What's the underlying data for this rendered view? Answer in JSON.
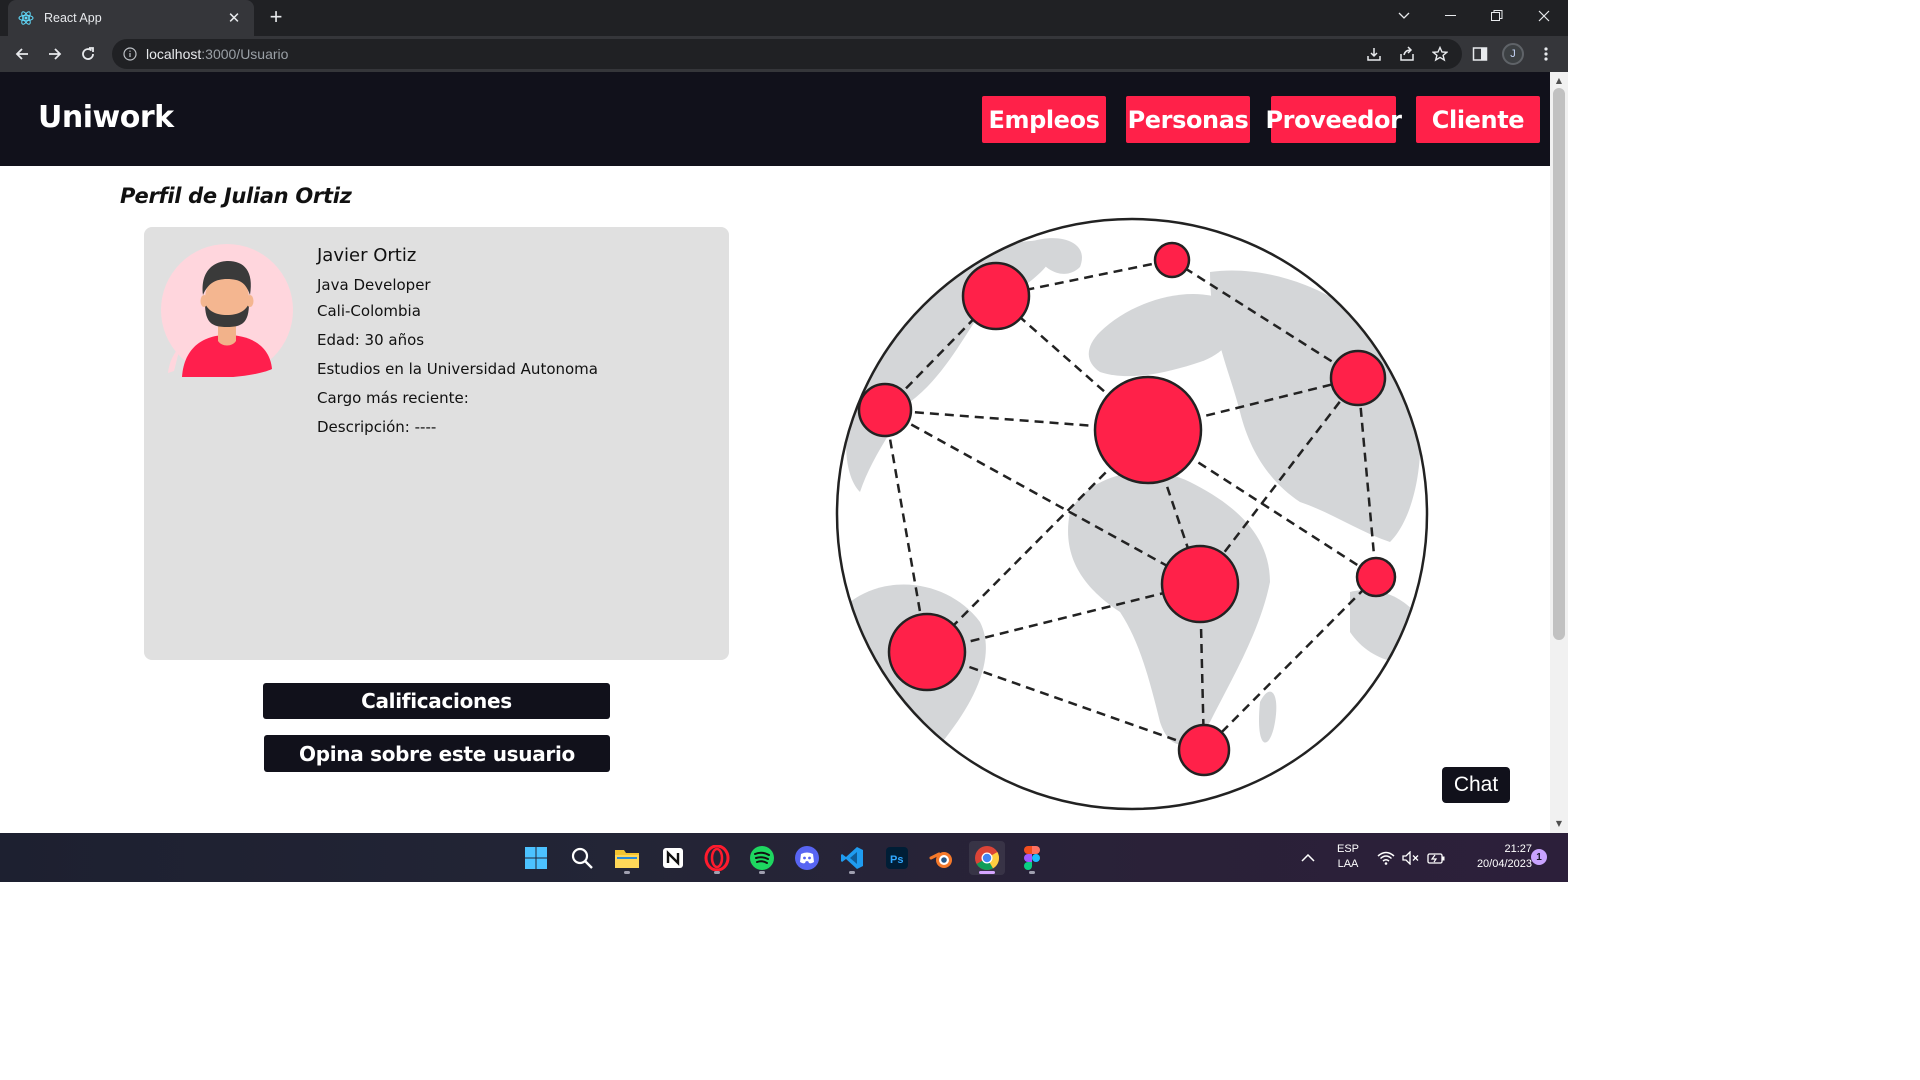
{
  "browser": {
    "tab_title": "React App",
    "tab_close": "✕",
    "new_tab": "+",
    "url_host": "localhost",
    "url_path": ":3000/Usuario",
    "profile_initial": "J"
  },
  "header": {
    "brand": "Uniwork",
    "nav": {
      "empleos": "Empleos",
      "personas": "Personas",
      "proveedor": "Proveedor",
      "cliente": "Cliente"
    },
    "brand_color": "#ff2149",
    "dark_color": "#11111b"
  },
  "page": {
    "title": "Perfil de Julian Ortiz"
  },
  "profile": {
    "name": "Javier Ortiz",
    "role": "Java Developer",
    "location": "Cali-Colombia",
    "age": "Edad: 30 años",
    "studies": "Estudios en la Universidad Autonoma",
    "recent_position": "Cargo más reciente:",
    "description": "Descripción: ----"
  },
  "actions": {
    "ratings": "Calificaciones",
    "review": "Opina sobre este usuario"
  },
  "chat": {
    "label": "Chat"
  },
  "taskbar": {
    "lang_top": "ESP",
    "lang_bottom": "LAA",
    "time": "21:27",
    "date": "20/04/2023",
    "notifications": "1",
    "apps": [
      "windows-start",
      "search",
      "file-explorer",
      "notion",
      "opera",
      "spotify",
      "discord",
      "vscode",
      "photoshop",
      "blender",
      "chrome",
      "figma"
    ]
  }
}
